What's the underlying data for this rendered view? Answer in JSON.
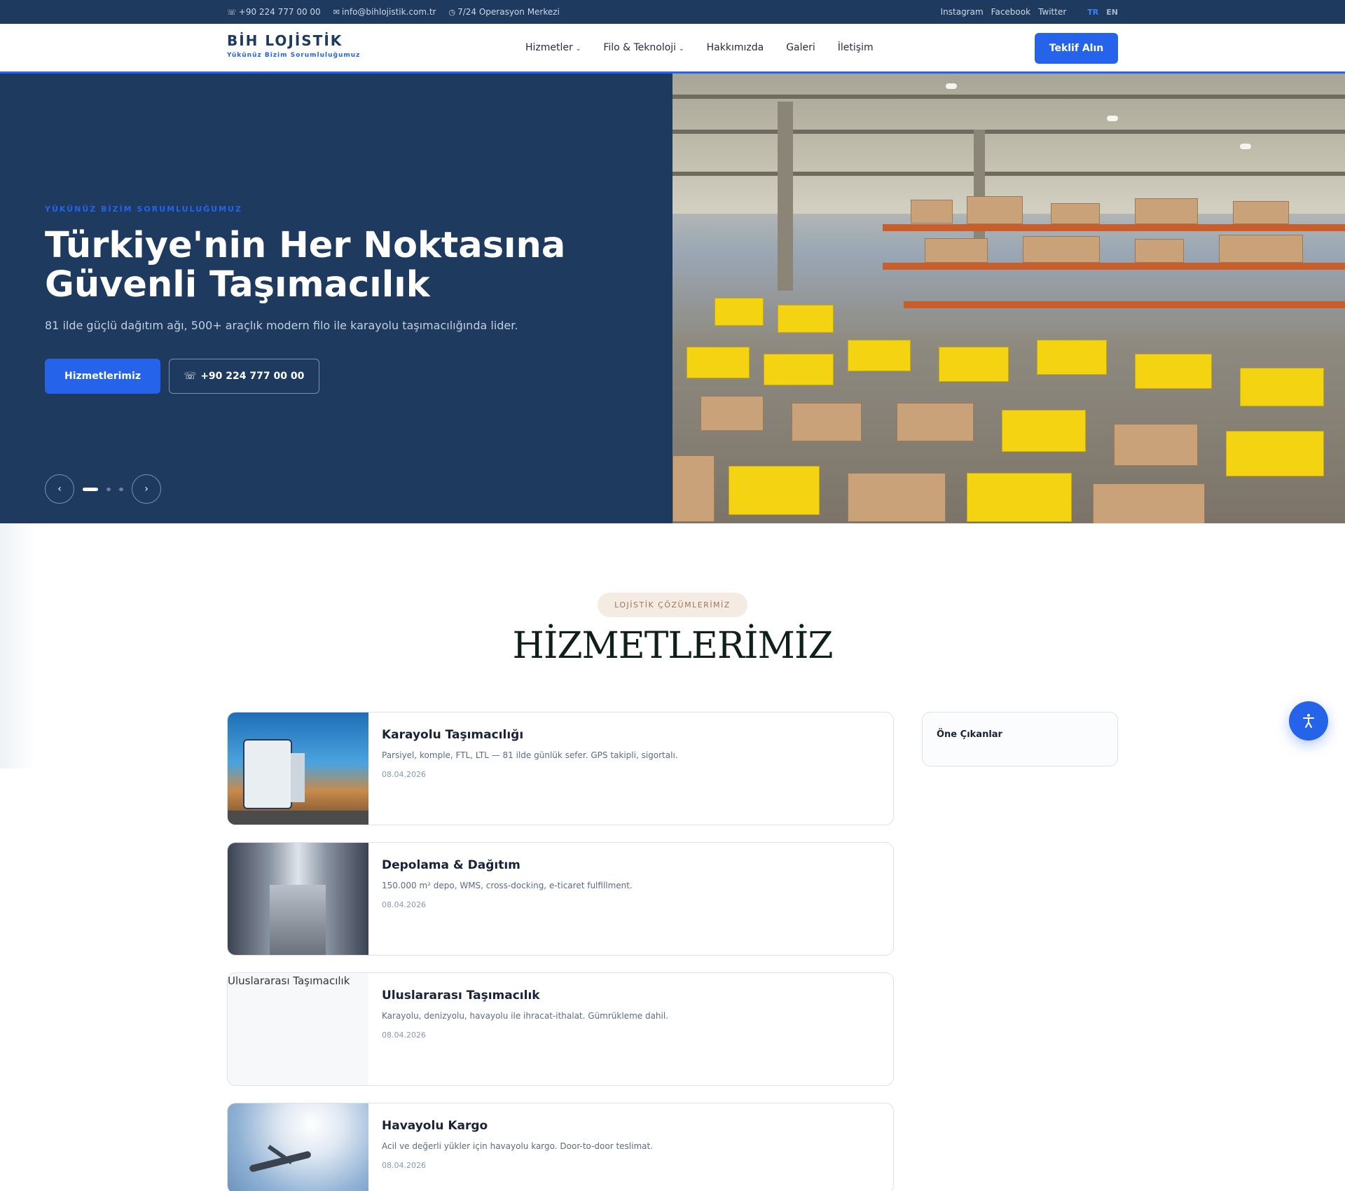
{
  "topbar": {
    "phone": "+90 224 777 00 00",
    "email": "info@bihlojistik.com.tr",
    "ops": "7/24 Operasyon Merkezi",
    "social": [
      "Instagram",
      "Facebook",
      "Twitter"
    ],
    "lang_active": "TR",
    "lang_other": "EN"
  },
  "header": {
    "brand_name": "BİH LOJİSTİK",
    "brand_tagline": "Yükünüz Bizim Sorumluluğumuz",
    "nav": [
      "Hizmetler",
      "Filo & Teknoloji",
      "Hakkımızda",
      "Galeri",
      "İletişim"
    ],
    "cta": "Teklif Alın"
  },
  "hero": {
    "eyebrow": "YÜKÜNÜZ BİZİM SORUMLULUĞUMUZ",
    "title_line1": "Türkiye'nin Her Noktasına",
    "title_line2": "Güvenli Taşımacılık",
    "subtitle": "81 ilde güçlü dağıtım ağı, 500+ araçlık modern filo ile karayolu taşımacılığında lider.",
    "primary_button": "Hizmetlerimiz",
    "secondary_button": "+90 224 777 00 00",
    "prev": "‹",
    "next": "›"
  },
  "services": {
    "eyebrow": "LOJİSTİK ÇÖZÜMLERİMİZ",
    "title": "HİZMETLERİMİZ",
    "items": [
      {
        "title": "Karayolu Taşımacılığı",
        "desc": "Parsiyel, komple, FTL, LTL — 81 ilde günlük sefer. GPS takipli, sigortalı.",
        "date": "08.04.2026"
      },
      {
        "title": "Depolama & Dağıtım",
        "desc": "150.000 m² depo, WMS, cross-docking, e-ticaret fulfillment.",
        "date": "08.04.2026"
      },
      {
        "title": "Uluslararası Taşımacılık",
        "desc": "Karayolu, denizyolu, havayolu ile ihracat-ithalat. Gümrükleme dahil.",
        "date": "08.04.2026",
        "img_alt": "Uluslararası Taşımacılık"
      },
      {
        "title": "Havayolu Kargo",
        "desc": "Acil ve değerli yükler için havayolu kargo. Door-to-door teslimat.",
        "date": "08.04.2026"
      }
    ]
  },
  "sidebar": {
    "title": "Öne Çıkanlar"
  },
  "colors": {
    "navy": "#1e3a5f",
    "accent": "#2563eb",
    "pill_bg": "#f4ece3"
  }
}
